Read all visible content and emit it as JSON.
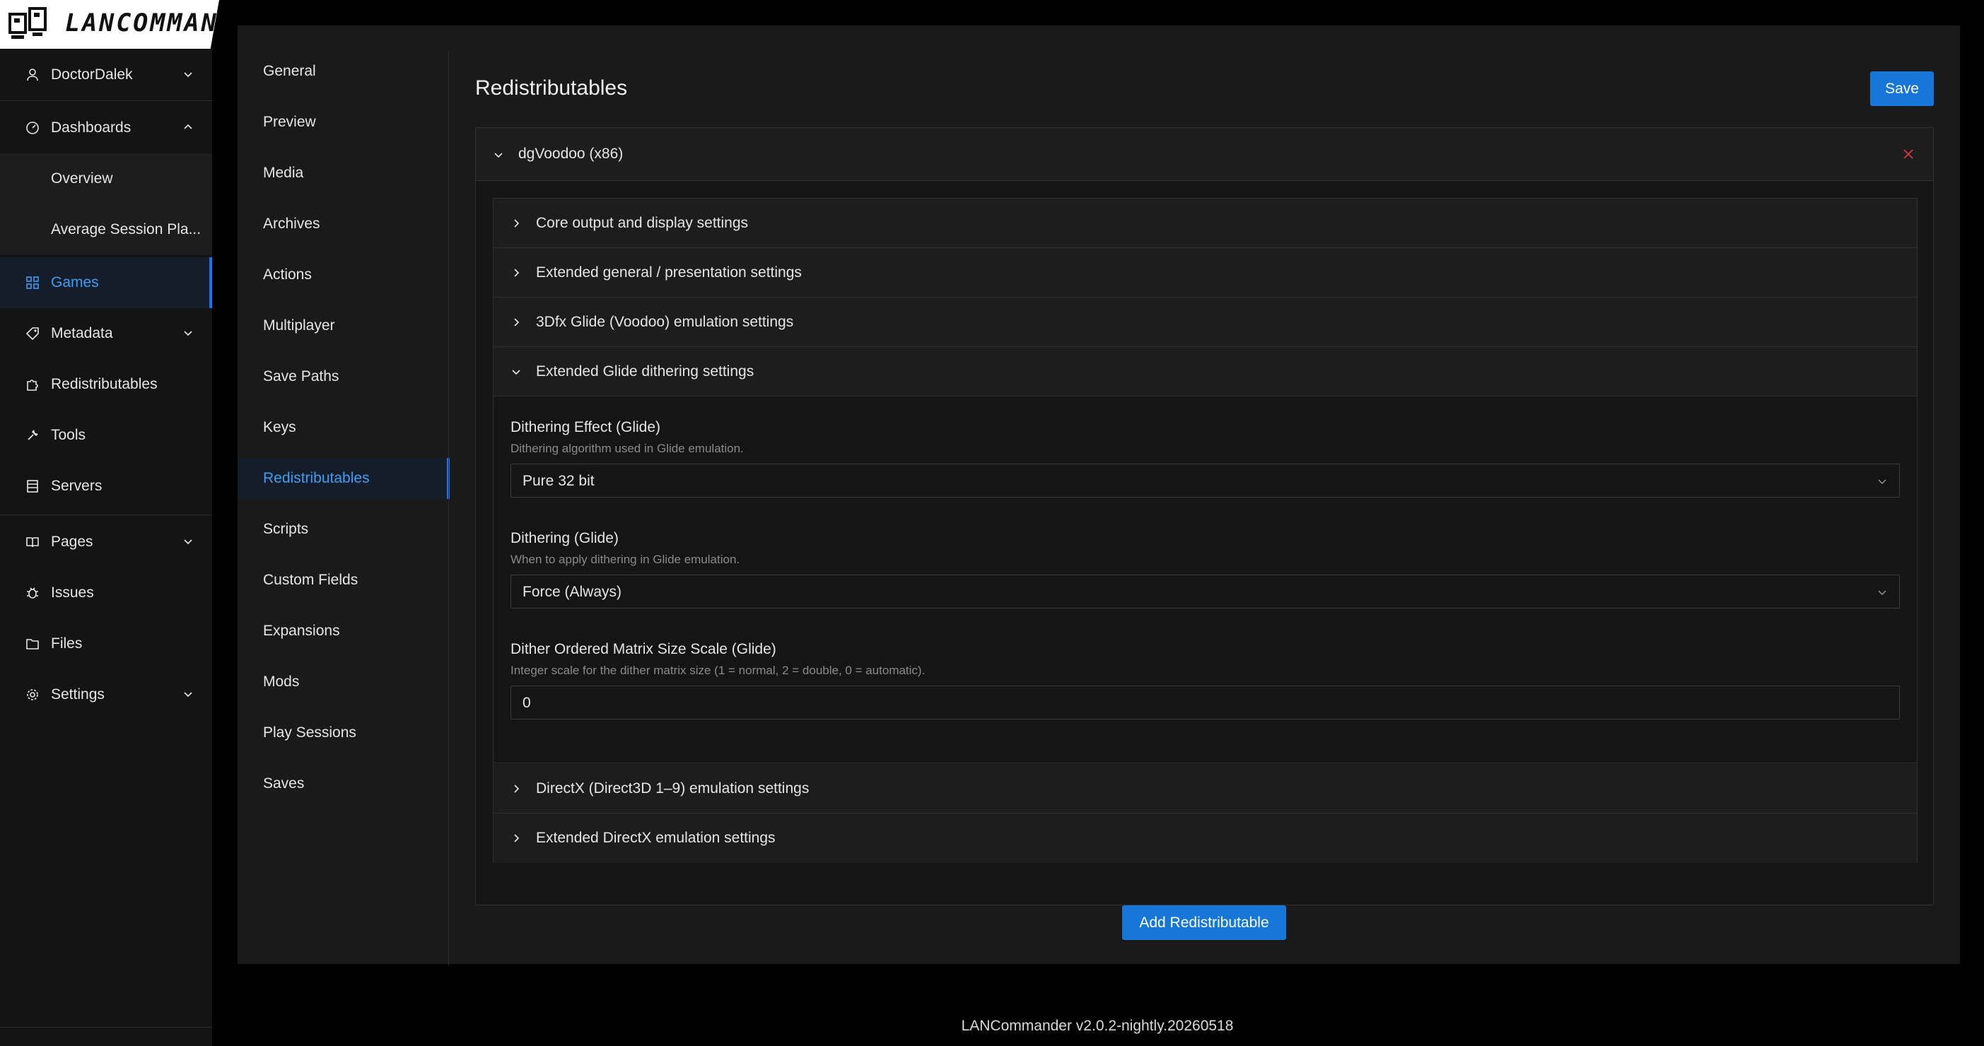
{
  "app": {
    "logo_text": "LANCOMMANDER",
    "version": "LANCommander v2.0.2-nightly.20260518"
  },
  "colors": {
    "accent": "#1677d9",
    "active_text": "#3d9ef4",
    "danger": "#d9363e"
  },
  "sidebar": {
    "user": {
      "label": "DoctorDalek",
      "icon": "user-icon"
    },
    "items": [
      {
        "label": "Dashboards",
        "icon": "dashboard-icon",
        "expanded": true
      },
      {
        "label": "Overview"
      },
      {
        "label": "Average Session Pla..."
      },
      {
        "label": "Games",
        "icon": "grid-icon",
        "active": true
      },
      {
        "label": "Metadata",
        "icon": "tag-icon",
        "expanded": false
      },
      {
        "label": "Redistributables",
        "icon": "puzzle-icon"
      },
      {
        "label": "Tools",
        "icon": "wrench-icon"
      },
      {
        "label": "Servers",
        "icon": "server-icon"
      },
      {
        "label": "Pages",
        "icon": "book-icon",
        "expanded": false
      },
      {
        "label": "Issues",
        "icon": "bug-icon"
      },
      {
        "label": "Files",
        "icon": "folder-icon"
      },
      {
        "label": "Settings",
        "icon": "gear-icon",
        "expanded": false
      }
    ]
  },
  "subnav": {
    "items": [
      "General",
      "Preview",
      "Media",
      "Archives",
      "Actions",
      "Multiplayer",
      "Save Paths",
      "Keys",
      "Redistributables",
      "Scripts",
      "Custom Fields",
      "Expansions",
      "Mods",
      "Play Sessions",
      "Saves"
    ],
    "active": "Redistributables"
  },
  "page": {
    "title": "Redistributables",
    "save_label": "Save",
    "add_label": "Add Redistributable"
  },
  "redistributable": {
    "name": "dgVoodoo (x86)",
    "sections": [
      "Core output and display settings",
      "Extended general / presentation settings",
      "3Dfx Glide (Voodoo) emulation settings",
      "Extended Glide dithering settings",
      "DirectX (Direct3D 1–9) emulation settings",
      "Extended DirectX emulation settings"
    ],
    "expanded_section": "Extended Glide dithering settings",
    "fields": [
      {
        "label": "Dithering Effect (Glide)",
        "help": "Dithering algorithm used in Glide emulation.",
        "value": "Pure 32 bit",
        "type": "select"
      },
      {
        "label": "Dithering (Glide)",
        "help": "When to apply dithering in Glide emulation.",
        "value": "Force (Always)",
        "type": "select"
      },
      {
        "label": "Dither Ordered Matrix Size Scale (Glide)",
        "help": "Integer scale for the dither matrix size (1 = normal, 2 = double, 0 = automatic).",
        "value": "0",
        "type": "number"
      }
    ]
  }
}
